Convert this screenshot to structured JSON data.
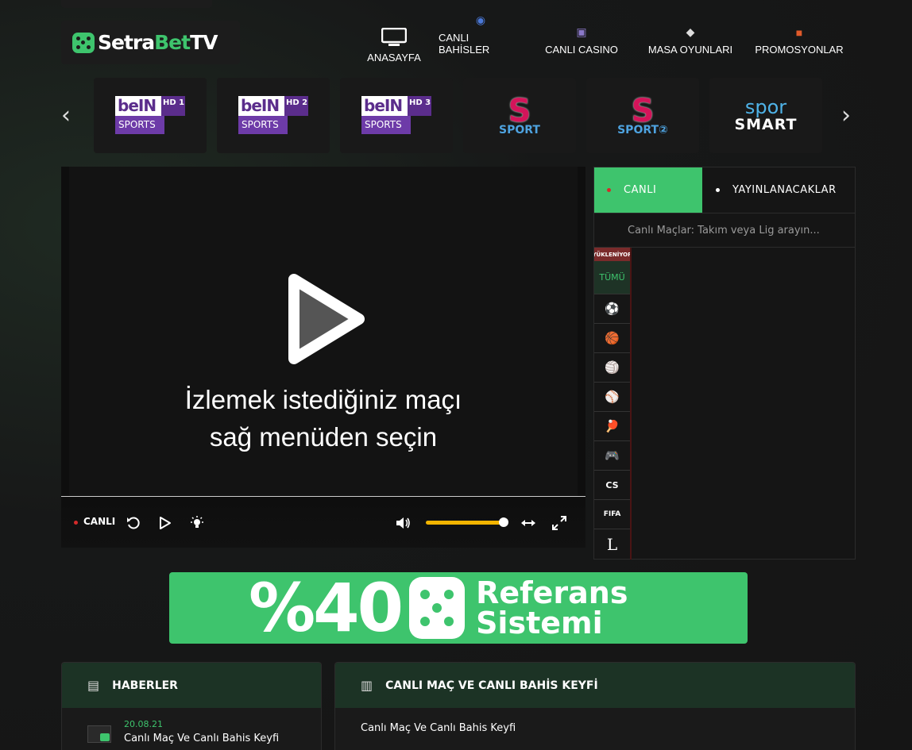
{
  "brand": {
    "name_part1": "Setra",
    "name_part2": "Bet",
    "name_part3": "TV"
  },
  "nav": [
    {
      "label": "ANASAYFA",
      "icon": "tv-icon"
    },
    {
      "label": "CANLI BAHİSLER",
      "icon": "globe-icon"
    },
    {
      "label": "CANLI CASINO",
      "icon": "slot-icon"
    },
    {
      "label": "MASA OYUNLARI",
      "icon": "dice-icon"
    },
    {
      "label": "PROMOSYONLAR",
      "icon": "gift-icon"
    }
  ],
  "channels": {
    "bein1": {
      "top": "beIN",
      "hd": "HD 1",
      "bottom": "SPORTS"
    },
    "bein2": {
      "top": "beIN",
      "hd": "HD 2",
      "bottom": "SPORTS"
    },
    "bein3": {
      "top": "beIN",
      "hd": "HD 3",
      "bottom": "SPORTS"
    },
    "ssport": {
      "mark": "S",
      "label": "SPORT"
    },
    "ssport2": {
      "mark": "S",
      "label": "SPORT②"
    },
    "spor_smart": {
      "line1": "spor",
      "line2": "SMART"
    }
  },
  "player": {
    "prompt_line1": "İzlemek istediğiniz maçı",
    "prompt_line2": "sağ menüden seçin",
    "live_label": "CANLI",
    "volume": 0.93
  },
  "sidebar": {
    "tab_live": "CANLI",
    "tab_upcoming": "YAYINLANACAKLAR",
    "search_placeholder": "Canlı Maçlar: Takım veya Lig arayın...",
    "loading": "YÜKLENİYOR",
    "all_label": "TÜMÜ",
    "sports": [
      "⚽",
      "🏀",
      "🏐",
      "⚾",
      "🏓",
      "🎮"
    ],
    "cs_label": "CS",
    "fifa_label": "FIFA",
    "lol_label": "L"
  },
  "banner": {
    "percent": "%40",
    "line1": "Referans",
    "line2": "Sistemi"
  },
  "news": {
    "title": "HABERLER",
    "item_date": "20.08.21",
    "item_title": "Canlı Maç Ve Canlı Bahis Keyfi"
  },
  "article": {
    "title": "CANLI MAÇ VE CANLI BAHİS KEYFİ",
    "subtitle": "Canlı Maç Ve Canlı Bahis Keyfi"
  },
  "colors": {
    "accent": "#3ec46d",
    "purple": "#5b2d8c",
    "volume": "#f2b400"
  }
}
